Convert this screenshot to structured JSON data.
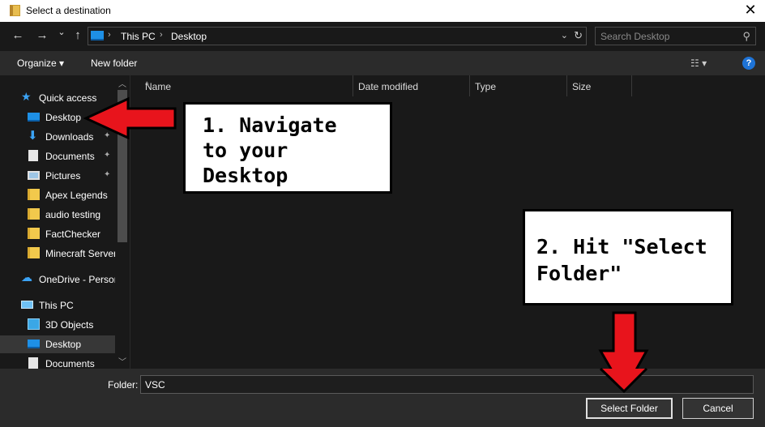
{
  "window": {
    "title": "Select a destination",
    "close_glyph": "✕"
  },
  "nav": {
    "back": "←",
    "forward": "→",
    "recent": "⌄",
    "up": "↑"
  },
  "address": {
    "crumbs": [
      "This PC",
      "Desktop"
    ],
    "separator": "›",
    "dropdown": "⌄",
    "refresh": "↻"
  },
  "search": {
    "placeholder": "Search Desktop",
    "icon": "⚲"
  },
  "commands": {
    "organize": "Organize ▾",
    "new_folder": "New folder",
    "view": "☷ ▾",
    "help": "?"
  },
  "sidebar": {
    "items": [
      {
        "label": "Quick access",
        "icon": "star-icon"
      },
      {
        "label": "Desktop",
        "icon": "desktop-icon",
        "pinned": true
      },
      {
        "label": "Downloads",
        "icon": "download-icon",
        "pinned": true
      },
      {
        "label": "Documents",
        "icon": "documents-icon",
        "pinned": true
      },
      {
        "label": "Pictures",
        "icon": "pictures-icon",
        "pinned": true
      },
      {
        "label": "Apex Legends",
        "icon": "folder-icon"
      },
      {
        "label": "audio testing",
        "icon": "folder-icon"
      },
      {
        "label": "FactChecker",
        "icon": "folder-icon"
      },
      {
        "label": "Minecraft Server",
        "icon": "folder-icon"
      },
      {
        "label": "OneDrive - Persor",
        "icon": "cloud-icon"
      },
      {
        "label": "This PC",
        "icon": "computer-icon"
      },
      {
        "label": "3D Objects",
        "icon": "cube-icon"
      },
      {
        "label": "Desktop",
        "icon": "desktop-icon"
      },
      {
        "label": "Documents",
        "icon": "documents-icon"
      }
    ],
    "pin_glyph": "📌"
  },
  "columns": [
    "Name",
    "Date modified",
    "Type",
    "Size"
  ],
  "annotations": {
    "step1": [
      "1. Navigate",
      "to your",
      "Desktop"
    ],
    "step2": [
      "2. Hit \"Select",
      "Folder\""
    ]
  },
  "footer": {
    "folder_label": "Folder:",
    "folder_value": "VSC",
    "select_button": "Select Folder",
    "cancel_button": "Cancel"
  },
  "colors": {
    "arrow_red": "#e8141c",
    "accent_blue": "#1e90e6"
  }
}
